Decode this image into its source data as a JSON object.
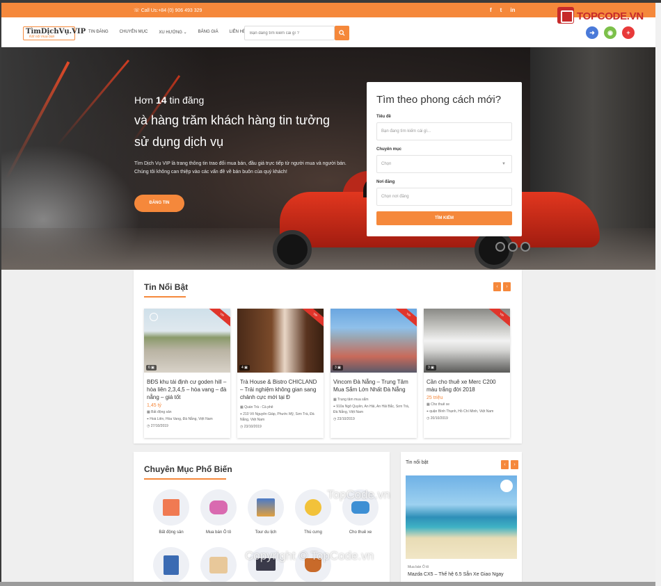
{
  "topbar": {
    "phone": "Call Us:+84 (0) 906 493 329",
    "social": [
      "f",
      "t",
      "in"
    ]
  },
  "header": {
    "logo_main": "TìmDịchVụ.VIP",
    "logo_tag": "Kết nối mua bán",
    "nav": [
      "TIN ĐĂNG",
      "CHUYÊN MỤC",
      "XU HƯỚNG ⌄",
      "BẢNG GIÁ",
      "LIÊN HỆ"
    ],
    "search_placeholder": "Bạn đang tìm kiếm cái gì ?",
    "icons": [
      "login-icon",
      "register-icon",
      "post-icon"
    ]
  },
  "watermark": {
    "logo_text": "TOPCODE.VN",
    "mid": "TopCode.vn",
    "bottom": "Copyright © TopCode.vn"
  },
  "hero": {
    "line1_prefix": "Hơn",
    "line1_num": "14",
    "line1_suffix": "tin đăng",
    "line2": "và hàng trăm khách hàng tin tưởng sử dụng dịch vụ",
    "desc": "Tìm Dịch Vụ VIP là trang thông tin trao đổi mua bán, đầu giá trực tiếp từ người mua và người bán. Chúng tôi không can thiệp vào các vấn đề về bán buôn của quý khách!",
    "button": "ĐĂNG TIN"
  },
  "search_box": {
    "title": "Tìm theo phong cách mới?",
    "label_title": "Tiêu đề",
    "ph_title": "Bạn đang tìm kiếm cái gì...",
    "label_cat": "Chuyên mục",
    "ph_cat": "Chọn",
    "label_loc": "Nơi đăng",
    "ph_loc": "Chọn nơi đăng",
    "button": "TÌM KIẾM"
  },
  "featured": {
    "title": "Tin Nổi Bật",
    "prev": "‹",
    "next": "›",
    "cards": [
      {
        "title": "BĐS khu tái định cư goden hill – hòa liên 2,3,4,5 – hòa vang – đà nẵng – giá tốt",
        "price": "1,45 tỷ",
        "cat": "Bất động sản",
        "loc": "Hoà Liên, Hòa Vang, Đà Nẵng, Việt Nam",
        "date": "27/10/2019",
        "count": "6",
        "badge": "VIP"
      },
      {
        "title": "Trà House & Bistro CHICLAND – Trải nghiệm không gian sang chảnh cực mới tại Đ",
        "price": "",
        "cat": "Quán Trà - Cà phê",
        "loc": "210 Võ Nguyên Giáp, Phước Mỹ, Sơn Trà, Đà Nẵng, Việt Nam",
        "date": "23/10/2019",
        "count": "4",
        "badge": "VIP"
      },
      {
        "title": "Vincom Đà Nẵng – Trung Tâm Mua Sắm Lớn Nhất Đà Nẵng",
        "price": "",
        "cat": "Trung tâm mua sắm",
        "loc": "910a Ngô Quyền, An Hải, An Hải Bắc, Sơn Trà, Đà Nẵng, Việt Nam",
        "date": "23/10/2019",
        "count": "3",
        "badge": "VIP"
      },
      {
        "title": "Cần cho thuê xe Merc C200 màu trắng đời 2018",
        "price": "25 triệu",
        "cat": "Cho thuê xe",
        "loc": "quận Bình Thạnh, Hồ Chí Minh, Việt Nam",
        "date": "20/10/2019",
        "count": "3",
        "badge": "VIP"
      }
    ]
  },
  "categories": {
    "title": "Chuyên Mục Phổ Biến",
    "items": [
      {
        "label": "Bất động sản",
        "icon": "building-icon"
      },
      {
        "label": "Mua bán Ô tô",
        "icon": "car-icon"
      },
      {
        "label": "Tour du lịch",
        "icon": "travel-icon"
      },
      {
        "label": "Thú cưng",
        "icon": "cat-icon"
      },
      {
        "label": "Cho thuê xe",
        "icon": "rent-car-icon"
      },
      {
        "label": "",
        "icon": "office-icon"
      },
      {
        "label": "",
        "icon": "restaurant-icon"
      },
      {
        "label": "",
        "icon": "laptop-icon"
      },
      {
        "label": "",
        "icon": "coffee-icon"
      }
    ]
  },
  "side": {
    "title": "Tin nổi bật",
    "cat": "Mua bán Ô tô",
    "post_title": "Mazda CX5 – Thế hệ 6.5 Sẵn Xe Giao Ngay"
  },
  "colors": {
    "accent": "#f5883b",
    "ribbon": "#e0352b"
  }
}
